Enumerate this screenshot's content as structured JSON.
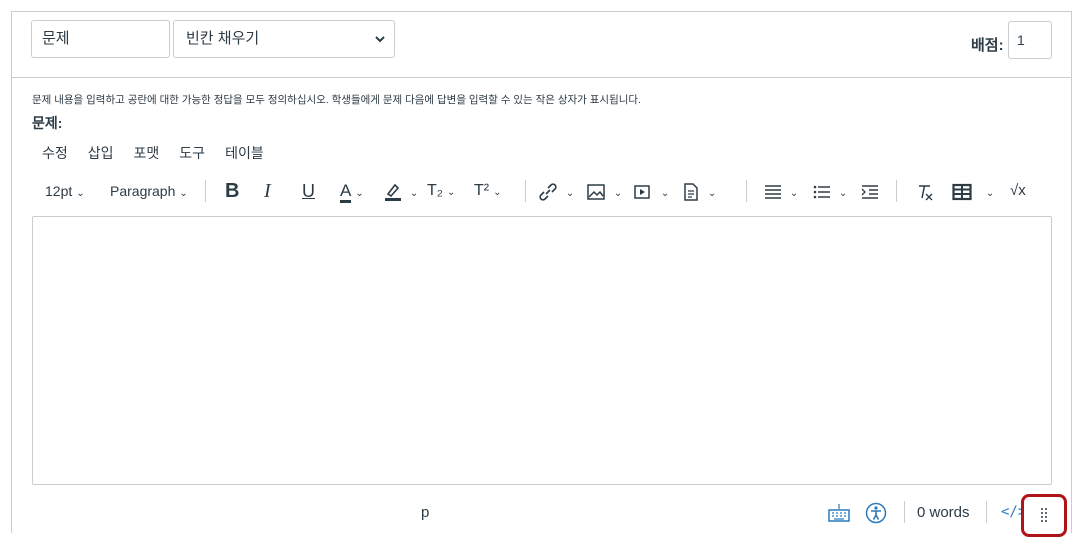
{
  "header": {
    "question_name_value": "문제",
    "question_type_selected": "빈칸 채우기",
    "points_label": "배점:",
    "points_value": "1"
  },
  "instructions": "문제 내용을 입력하고 공란에 대한 가능한 정답을 모두 정의하십시오. 학생들에게 문제 다음에 답변을 입력할 수 있는 작은 상자가 표시됩니다.",
  "question_label": "문제:",
  "menubar": [
    "수정",
    "삽입",
    "포맷",
    "도구",
    "테이블"
  ],
  "toolbar": {
    "font_size": "12pt",
    "block_format": "Paragraph",
    "bold": "B",
    "italic": "I",
    "underline": "U",
    "text_color": "A",
    "subscript": "T₂",
    "superscript": "T²",
    "equation": "√x",
    "icons": [
      "bold-icon",
      "italic-icon",
      "underline-icon",
      "text-color-icon",
      "highlight-icon",
      "subscript-icon",
      "superscript-icon",
      "link-icon",
      "image-icon",
      "media-icon",
      "document-icon",
      "align-icon",
      "list-icon",
      "indent-icon",
      "clear-formatting-icon",
      "table-icon",
      "equation-icon"
    ]
  },
  "statusbar": {
    "path": "p",
    "word_count": "0 words",
    "html_toggle": "</>",
    "icons": [
      "keyboard-icon",
      "accessibility-icon",
      "resize-handle-icon"
    ]
  },
  "colors": {
    "border": "#c7cdd1",
    "text": "#2d3b45",
    "accent_blue": "#2b7abc",
    "highlight_red": "#b0141a"
  }
}
